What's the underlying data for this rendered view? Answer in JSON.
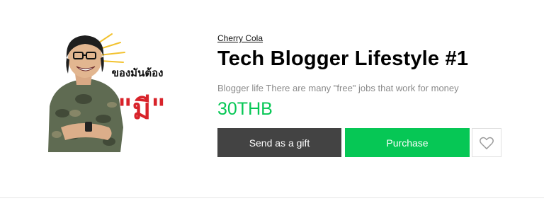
{
  "sticker": {
    "image_name": "sticker-preview",
    "caption_small": "ของมันต้อง",
    "caption_big": "\"มี\""
  },
  "product": {
    "author": "Cherry Cola",
    "title": "Tech Blogger Lifestyle #1",
    "description": "Blogger life There are many \"free\" jobs that work for money",
    "price": "30THB"
  },
  "actions": {
    "gift_label": "Send as a gift",
    "purchase_label": "Purchase",
    "like_icon": "heart-icon"
  },
  "colors": {
    "accent": "#06c755",
    "gift_button": "#434343",
    "caption_red": "#d8232a"
  }
}
